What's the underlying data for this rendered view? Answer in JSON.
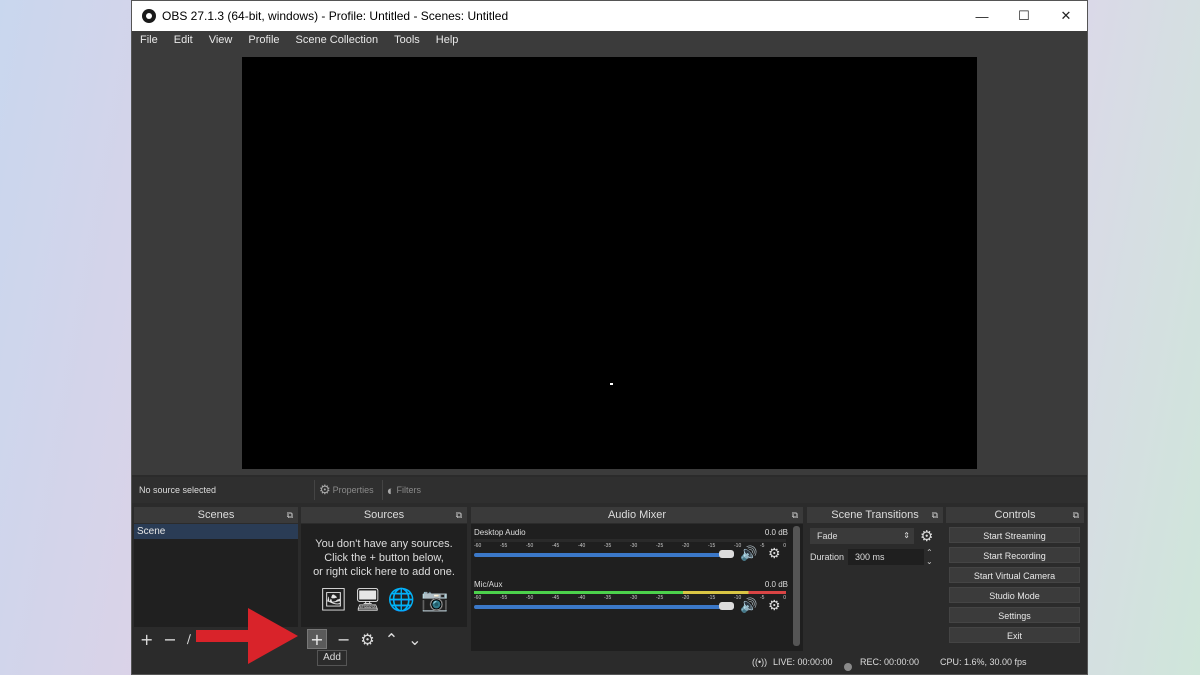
{
  "window": {
    "title": "OBS 27.1.3 (64-bit, windows) - Profile: Untitled - Scenes: Untitled",
    "controls": {
      "minimize": "—",
      "maximize": "☐",
      "close": "✕"
    }
  },
  "menu": [
    "File",
    "Edit",
    "View",
    "Profile",
    "Scene Collection",
    "Tools",
    "Help"
  ],
  "source_toolbar": {
    "status": "No source selected",
    "properties": "Properties",
    "filters": "Filters"
  },
  "scenes": {
    "title": "Scenes",
    "items": [
      "Scene"
    ]
  },
  "sources": {
    "title": "Sources",
    "empty_line1": "You don't have any sources.",
    "empty_line2": "Click the + button below,",
    "empty_line3": "or right click here to add one.",
    "tooltip": "Add"
  },
  "audio_mixer": {
    "title": "Audio Mixer",
    "tick_labels": [
      "-60",
      "-55",
      "-50",
      "-45",
      "-40",
      "-35",
      "-30",
      "-25",
      "-20",
      "-15",
      "-10",
      "-5",
      "0"
    ],
    "channels": [
      {
        "name": "Desktop Audio",
        "db": "0.0 dB"
      },
      {
        "name": "Mic/Aux",
        "db": "0.0 dB"
      }
    ]
  },
  "scene_transitions": {
    "title": "Scene Transitions",
    "transition": "Fade",
    "duration_label": "Duration",
    "duration_value": "300 ms"
  },
  "controls": {
    "title": "Controls",
    "buttons": [
      "Start Streaming",
      "Start Recording",
      "Start Virtual Camera",
      "Studio Mode",
      "Settings",
      "Exit"
    ]
  },
  "status": {
    "live": "LIVE: 00:00:00",
    "rec": "REC: 00:00:00",
    "cpu": "CPU: 1.6%, 30.00 fps"
  },
  "colors": {
    "accent_blue": "#3b78c8",
    "annotation_arrow": "#d9232a",
    "meter_green": "#4cd14c",
    "meter_yellow": "#d9c544",
    "meter_red": "#d94444"
  }
}
